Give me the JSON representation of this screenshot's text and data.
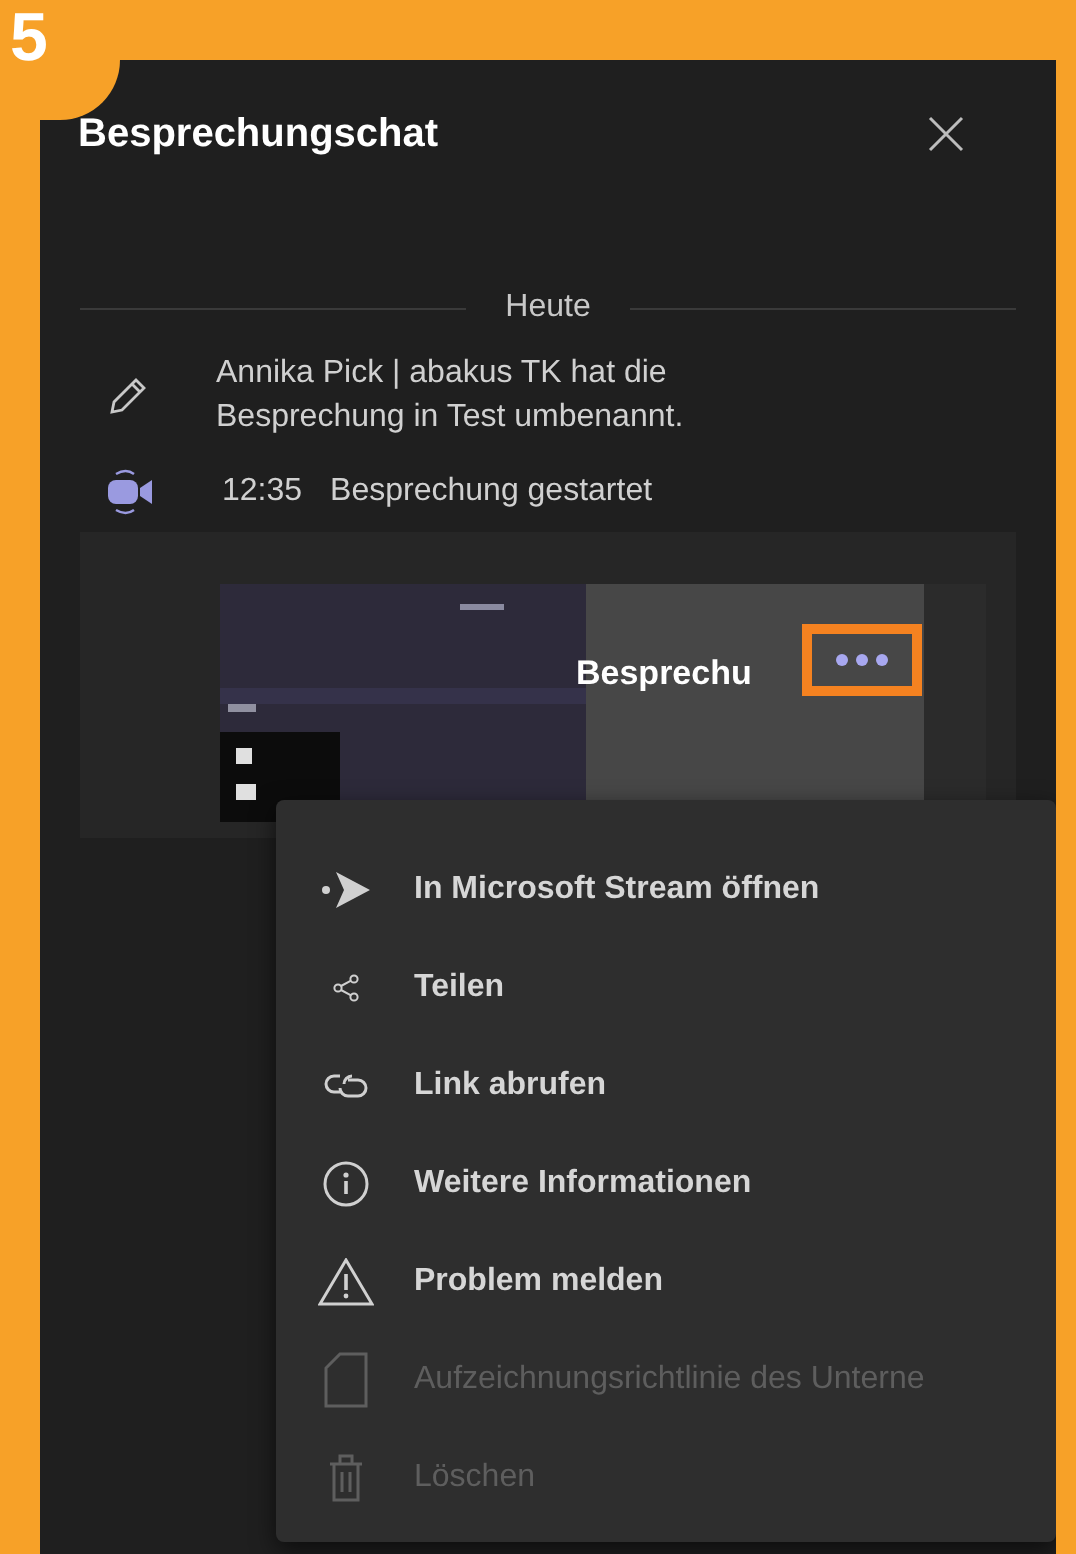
{
  "step_badge": "5",
  "header": {
    "title": "Besprechungschat"
  },
  "date_divider": "Heute",
  "events": [
    {
      "kind": "rename",
      "text": "Annika Pick | abakus TK hat die Besprechung in Test umbenannt."
    },
    {
      "kind": "meeting",
      "time": "12:35",
      "text": "Besprechung gestartet"
    }
  ],
  "recording": {
    "title": "Besprechu",
    "more_highlighted": true
  },
  "context_menu": [
    {
      "kind": "stream",
      "label": "In Microsoft Stream öffnen",
      "disabled": false
    },
    {
      "kind": "share",
      "label": "Teilen",
      "disabled": false
    },
    {
      "kind": "link",
      "label": "Link abrufen",
      "disabled": false
    },
    {
      "kind": "info",
      "label": "Weitere Informationen",
      "disabled": false
    },
    {
      "kind": "warning",
      "label": "Problem melden",
      "disabled": false
    },
    {
      "kind": "policy",
      "label": "Aufzeichnungsrichtlinie des Unterne",
      "disabled": true
    },
    {
      "kind": "delete",
      "label": "Löschen",
      "disabled": true
    }
  ]
}
